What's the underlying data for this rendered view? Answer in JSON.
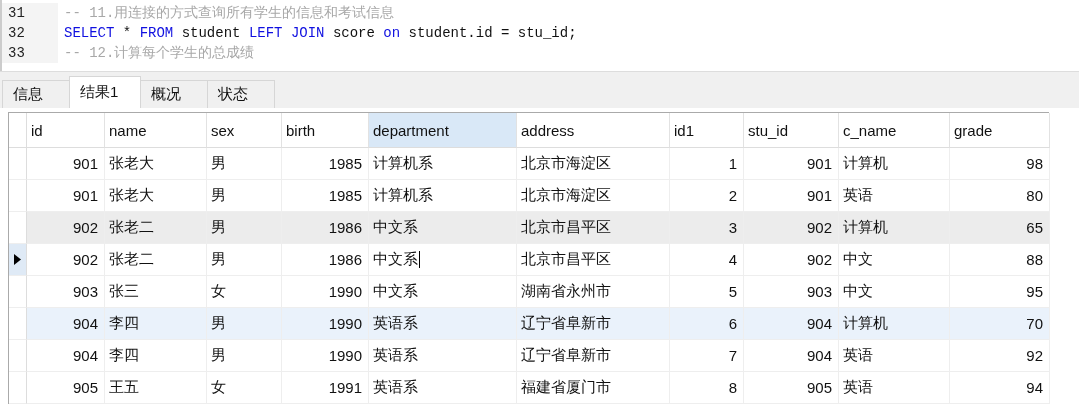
{
  "editor": {
    "lines": [
      {
        "number": "31",
        "tokens": [
          {
            "kind": "comment",
            "text": "-- 11.用连接的方式查询所有学生的信息和考试信息"
          }
        ]
      },
      {
        "number": "32",
        "tokens": [
          {
            "kind": "keyword",
            "text": "SELECT"
          },
          {
            "kind": "plain",
            "text": " * "
          },
          {
            "kind": "keyword",
            "text": "FROM"
          },
          {
            "kind": "plain",
            "text": " student "
          },
          {
            "kind": "keyword",
            "text": "LEFT JOIN"
          },
          {
            "kind": "plain",
            "text": " score "
          },
          {
            "kind": "keyword",
            "text": "on"
          },
          {
            "kind": "plain",
            "text": " student.id = stu_id;"
          }
        ]
      },
      {
        "number": "33",
        "tokens": [
          {
            "kind": "comment",
            "text": "-- 12.计算每个学生的总成绩"
          }
        ]
      }
    ]
  },
  "tabs": [
    {
      "label": "信息",
      "selected": false
    },
    {
      "label": "结果1",
      "selected": true
    },
    {
      "label": "概况",
      "selected": false
    },
    {
      "label": "状态",
      "selected": false
    }
  ],
  "table": {
    "columns": [
      {
        "label": "id",
        "kind": "number",
        "selected": false
      },
      {
        "label": "name",
        "kind": "text",
        "selected": false
      },
      {
        "label": "sex",
        "kind": "text",
        "selected": false
      },
      {
        "label": "birth",
        "kind": "number",
        "selected": false
      },
      {
        "label": "department",
        "kind": "text",
        "selected": true
      },
      {
        "label": "address",
        "kind": "text",
        "selected": false
      },
      {
        "label": "id1",
        "kind": "number",
        "selected": false
      },
      {
        "label": "stu_id",
        "kind": "number",
        "selected": false
      },
      {
        "label": "c_name",
        "kind": "text",
        "selected": false
      },
      {
        "label": "grade",
        "kind": "number",
        "selected": false
      }
    ],
    "rows": [
      {
        "current": false,
        "hovered": false,
        "selected": false,
        "editing": false,
        "cells": [
          "901",
          "张老大",
          "男",
          "1985",
          "计算机系",
          "北京市海淀区",
          "1",
          "901",
          "计算机",
          "98"
        ]
      },
      {
        "current": false,
        "hovered": false,
        "selected": false,
        "editing": false,
        "cells": [
          "901",
          "张老大",
          "男",
          "1985",
          "计算机系",
          "北京市海淀区",
          "2",
          "901",
          "英语",
          "80"
        ]
      },
      {
        "current": false,
        "hovered": true,
        "selected": false,
        "editing": false,
        "cells": [
          "902",
          "张老二",
          "男",
          "1986",
          "中文系",
          "北京市昌平区",
          "3",
          "902",
          "计算机",
          "65"
        ]
      },
      {
        "current": true,
        "hovered": false,
        "selected": false,
        "editing": true,
        "cells": [
          "902",
          "张老二",
          "男",
          "1986",
          "中文系",
          "北京市昌平区",
          "4",
          "902",
          "中文",
          "88"
        ]
      },
      {
        "current": false,
        "hovered": false,
        "selected": false,
        "editing": false,
        "cells": [
          "903",
          "张三",
          "女",
          "1990",
          "中文系",
          "湖南省永州市",
          "5",
          "903",
          "中文",
          "95"
        ]
      },
      {
        "current": false,
        "hovered": false,
        "selected": true,
        "editing": false,
        "cells": [
          "904",
          "李四",
          "男",
          "1990",
          "英语系",
          "辽宁省阜新市",
          "6",
          "904",
          "计算机",
          "70"
        ]
      },
      {
        "current": false,
        "hovered": false,
        "selected": false,
        "editing": false,
        "cells": [
          "904",
          "李四",
          "男",
          "1990",
          "英语系",
          "辽宁省阜新市",
          "7",
          "904",
          "英语",
          "92"
        ]
      },
      {
        "current": false,
        "hovered": false,
        "selected": false,
        "editing": false,
        "cells": [
          "905",
          "王五",
          "女",
          "1991",
          "英语系",
          "福建省厦门市",
          "8",
          "905",
          "英语",
          "94"
        ]
      }
    ]
  }
}
